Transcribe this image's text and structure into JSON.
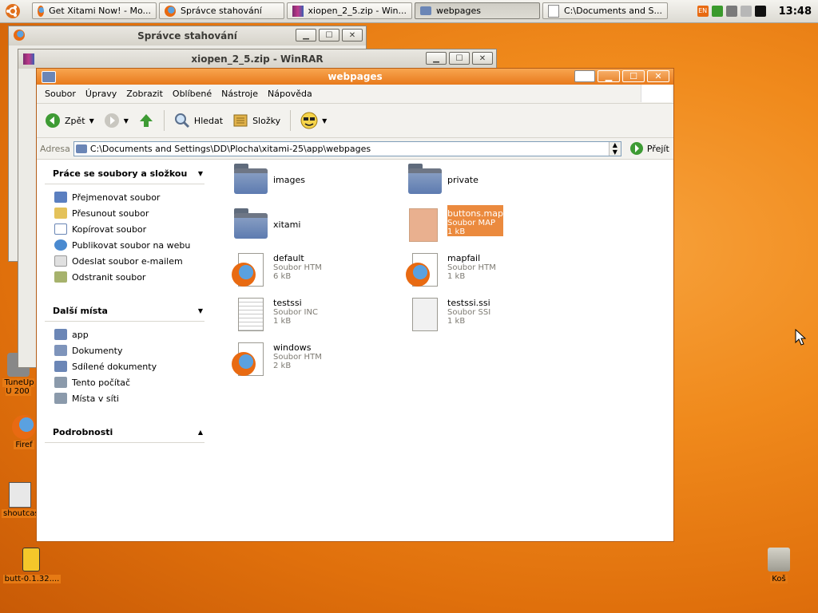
{
  "panel": {
    "tasks": [
      {
        "label": "Get Xitami Now! - Mo...",
        "icon": "firefox-icon"
      },
      {
        "label": "Správce stahování",
        "icon": "firefox-icon"
      },
      {
        "label": "xiopen_2_5.zip - Win...",
        "icon": "winrar-icon"
      },
      {
        "label": "webpages",
        "icon": "folder-icon",
        "active": true
      },
      {
        "label": "C:\\Documents and S...",
        "icon": "folder-icon"
      }
    ],
    "clock": "13:48",
    "lang": "EN"
  },
  "desktop": {
    "icons": [
      {
        "label": "TuneUp U 200",
        "name": "tuneup-icon"
      },
      {
        "label": "Firef",
        "name": "firefox-desktop-icon"
      },
      {
        "label": "shoutcas",
        "name": "shoutcast-icon"
      },
      {
        "label": "butt-0.1.32....",
        "name": "butt-icon"
      },
      {
        "label": "Koš",
        "name": "trash-icon"
      }
    ]
  },
  "bg_windows": {
    "downloads_title": "Správce stahování",
    "winrar_title": "xiopen_2_5.zip - WinRAR"
  },
  "window": {
    "title": "webpages",
    "menu": [
      "Soubor",
      "Úpravy",
      "Zobrazit",
      "Oblíbené",
      "Nástroje",
      "Nápověda"
    ],
    "toolbar": {
      "back": "Zpět",
      "search": "Hledat",
      "folders": "Složky"
    },
    "address": {
      "label": "Adresa",
      "path": "C:\\Documents and Settings\\DD\\Plocha\\xitami-25\\app\\webpages",
      "go": "Přejít"
    }
  },
  "sidebar": {
    "tasks": {
      "title": "Práce se soubory a složkou",
      "items": [
        "Přejmenovat soubor",
        "Přesunout soubor",
        "Kopírovat soubor",
        "Publikovat soubor na webu",
        "Odeslat soubor e-mailem",
        "Odstranit soubor"
      ]
    },
    "places": {
      "title": "Další místa",
      "items": [
        "app",
        "Dokumenty",
        "Sdílené dokumenty",
        "Tento počítač",
        "Místa v síti"
      ]
    },
    "details": {
      "title": "Podrobnosti"
    }
  },
  "files": [
    {
      "name": "images",
      "type": "",
      "size": "",
      "kind": "folder"
    },
    {
      "name": "private",
      "type": "",
      "size": "",
      "kind": "folder"
    },
    {
      "name": "xitami",
      "type": "",
      "size": "",
      "kind": "folder"
    },
    {
      "name": "buttons.map",
      "type": "Soubor MAP",
      "size": "1 kB",
      "kind": "map",
      "selected": true
    },
    {
      "name": "default",
      "type": "Soubor HTM",
      "size": "6 kB",
      "kind": "htm"
    },
    {
      "name": "mapfail",
      "type": "Soubor HTM",
      "size": "1 kB",
      "kind": "htm"
    },
    {
      "name": "testssi",
      "type": "Soubor INC",
      "size": "1 kB",
      "kind": "doc"
    },
    {
      "name": "testssi.ssi",
      "type": "Soubor SSI",
      "size": "1 kB",
      "kind": "blank"
    },
    {
      "name": "windows",
      "type": "Soubor HTM",
      "size": "2 kB",
      "kind": "htm"
    }
  ]
}
